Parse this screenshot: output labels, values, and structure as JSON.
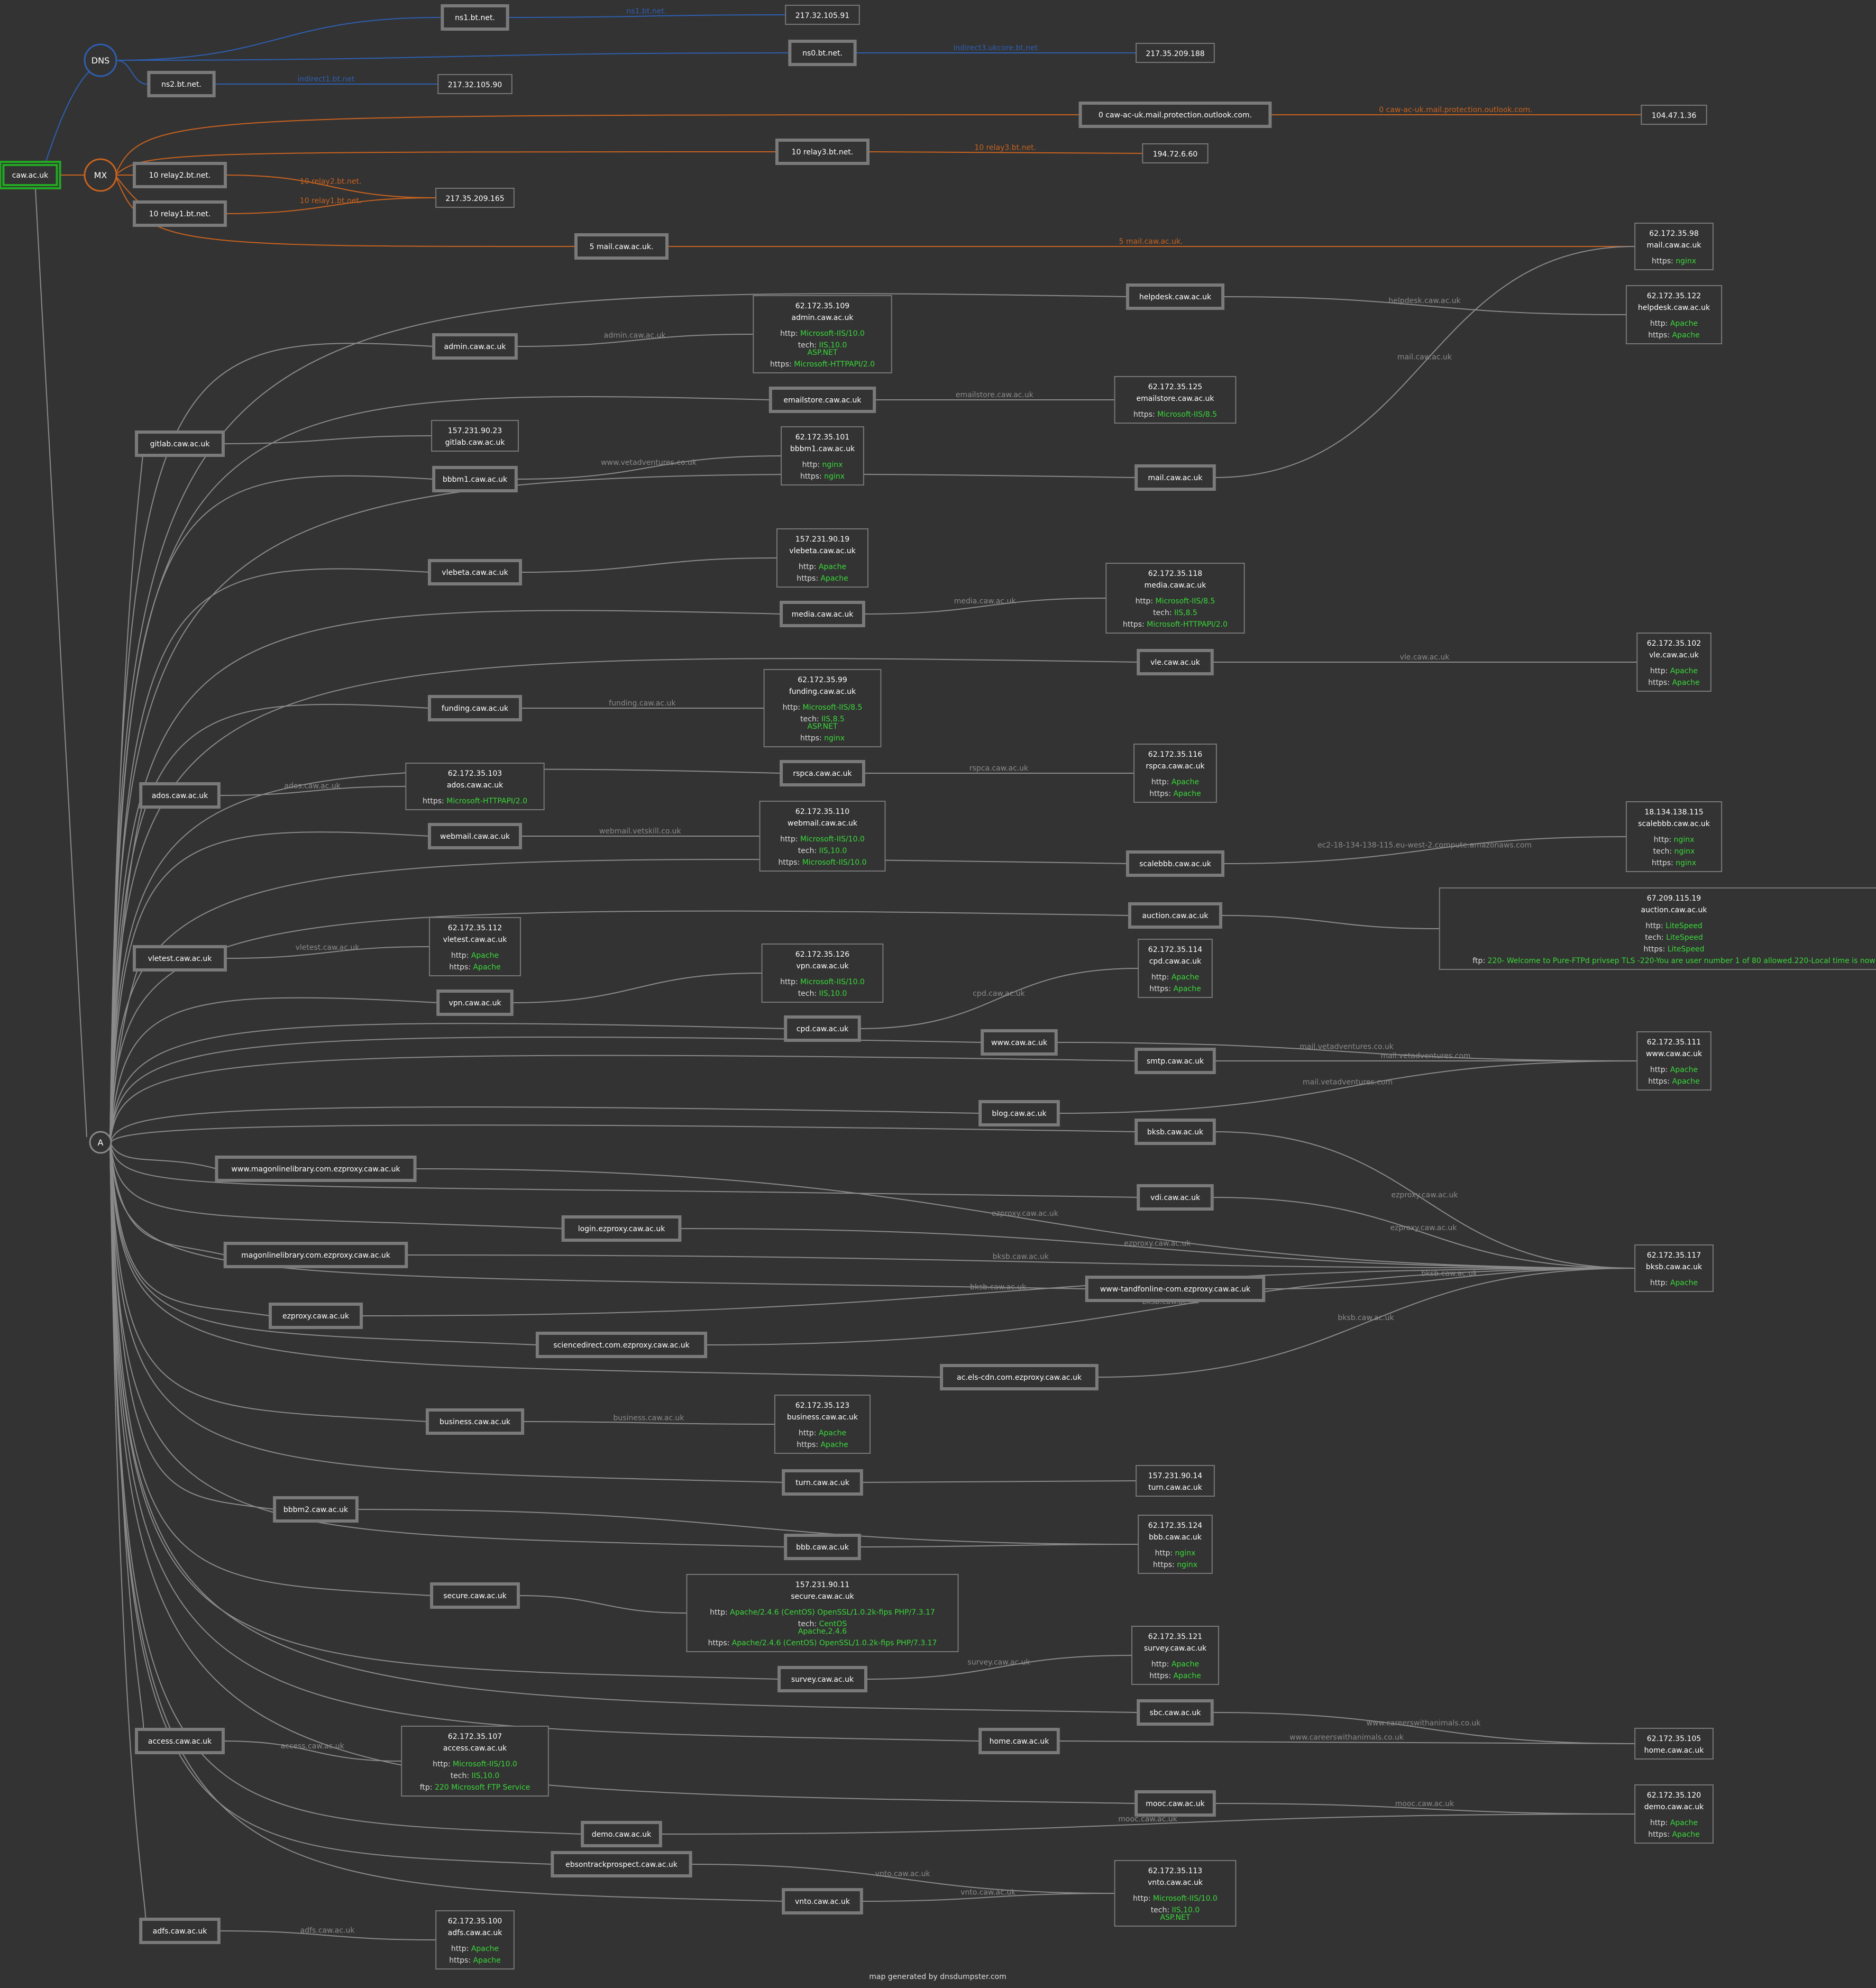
{
  "footer": "map generated by dnsdumpster.com",
  "colors": {
    "background": "#333333",
    "dns": "#2e5fb0",
    "mx": "#c8621f",
    "a": "#8a8a8a",
    "value": "#39d839",
    "root": "#22aa22"
  },
  "root": "caw.ac.uk",
  "hubs": [
    {
      "id": "DNS",
      "label": "DNS"
    },
    {
      "id": "MX",
      "label": "MX"
    },
    {
      "id": "A",
      "label": "A"
    }
  ],
  "dns_records": [
    {
      "host": "ns1.bt.net.",
      "ip": "217.32.105.91",
      "edge_label": "ns1.bt.net."
    },
    {
      "host": "ns0.bt.net.",
      "ip": "217.35.209.188",
      "edge_label": "indirect3.ukcore.bt.net"
    },
    {
      "host": "ns2.bt.net.",
      "ip": "217.32.105.90",
      "edge_label": "indirect1.bt.net"
    }
  ],
  "mx_records": [
    {
      "host": "0 caw-ac-uk.mail.protection.outlook.com.",
      "ip": "104.47.1.36",
      "edge_label": "0 caw-ac-uk.mail.protection.outlook.com."
    },
    {
      "host": "10 relay3.bt.net.",
      "ip": "194.72.6.60",
      "edge_label": "10 relay3.bt.net."
    },
    {
      "host": "10 relay2.bt.net.",
      "ip": "217.35.209.165",
      "edge_label": "10 relay2.bt.net."
    },
    {
      "host": "10 relay1.bt.net.",
      "ip": "217.35.209.165",
      "edge_label": "10 relay1.bt.net."
    },
    {
      "host": "5 mail.caw.ac.uk.",
      "ip": "62.172.35.98",
      "edge_label": "5 mail.caw.ac.uk."
    }
  ],
  "ip_info": [
    {
      "ip": "217.32.105.91",
      "lines": []
    },
    {
      "ip": "217.35.209.188",
      "lines": []
    },
    {
      "ip": "217.32.105.90",
      "lines": []
    },
    {
      "ip": "104.47.1.36",
      "lines": []
    },
    {
      "ip": "194.72.6.60",
      "lines": []
    },
    {
      "ip": "217.35.209.165",
      "lines": []
    },
    {
      "ip": "62.172.35.98",
      "host": "mail.caw.ac.uk",
      "lines": [
        {
          "k": "https:",
          "v": "nginx"
        }
      ]
    },
    {
      "ip": "62.172.35.122",
      "host": "helpdesk.caw.ac.uk",
      "lines": [
        {
          "k": "http:",
          "v": "Apache"
        },
        {
          "k": "https:",
          "v": "Apache"
        }
      ]
    },
    {
      "ip": "62.172.35.109",
      "host": "admin.caw.ac.uk",
      "lines": [
        {
          "k": "http:",
          "v": "Microsoft-IIS/10.0"
        },
        {
          "k": "tech:",
          "v": "IIS,10.0"
        },
        {
          "k": "",
          "v": "ASP.NET"
        },
        {
          "k": "https:",
          "v": "Microsoft-HTTPAPI/2.0"
        }
      ]
    },
    {
      "ip": "62.172.35.125",
      "host": "emailstore.caw.ac.uk",
      "lines": [
        {
          "k": "https:",
          "v": "Microsoft-IIS/8.5"
        }
      ]
    },
    {
      "ip": "157.231.90.23",
      "host": "gitlab.caw.ac.uk",
      "lines": []
    },
    {
      "ip": "62.172.35.101",
      "host": "bbbm1.caw.ac.uk",
      "lines": [
        {
          "k": "http:",
          "v": "nginx"
        },
        {
          "k": "https:",
          "v": "nginx"
        }
      ]
    },
    {
      "ip": "157.231.90.19",
      "host": "vlebeta.caw.ac.uk",
      "lines": [
        {
          "k": "http:",
          "v": "Apache"
        },
        {
          "k": "https:",
          "v": "Apache"
        }
      ]
    },
    {
      "ip": "62.172.35.118",
      "host": "media.caw.ac.uk",
      "lines": [
        {
          "k": "http:",
          "v": "Microsoft-IIS/8.5"
        },
        {
          "k": "tech:",
          "v": "IIS,8.5"
        },
        {
          "k": "https:",
          "v": "Microsoft-HTTPAPI/2.0"
        }
      ]
    },
    {
      "ip": "62.172.35.102",
      "host": "vle.caw.ac.uk",
      "lines": [
        {
          "k": "http:",
          "v": "Apache"
        },
        {
          "k": "https:",
          "v": "Apache"
        }
      ]
    },
    {
      "ip": "62.172.35.99",
      "host": "funding.caw.ac.uk",
      "lines": [
        {
          "k": "http:",
          "v": "Microsoft-IIS/8.5"
        },
        {
          "k": "tech:",
          "v": "IIS,8.5"
        },
        {
          "k": "",
          "v": "ASP.NET"
        },
        {
          "k": "https:",
          "v": "nginx"
        }
      ]
    },
    {
      "ip": "62.172.35.116",
      "host": "rspca.caw.ac.uk",
      "lines": [
        {
          "k": "http:",
          "v": "Apache"
        },
        {
          "k": "https:",
          "v": "Apache"
        }
      ]
    },
    {
      "ip": "62.172.35.103",
      "host": "ados.caw.ac.uk",
      "lines": [
        {
          "k": "https:",
          "v": "Microsoft-HTTPAPI/2.0"
        }
      ]
    },
    {
      "ip": "62.172.35.110",
      "host": "webmail.caw.ac.uk",
      "lines": [
        {
          "k": "http:",
          "v": "Microsoft-IIS/10.0"
        },
        {
          "k": "tech:",
          "v": "IIS,10.0"
        },
        {
          "k": "https:",
          "v": "Microsoft-IIS/10.0"
        }
      ]
    },
    {
      "ip": "18.134.138.115",
      "host": "scalebbb.caw.ac.uk",
      "lines": [
        {
          "k": "http:",
          "v": "nginx"
        },
        {
          "k": "tech:",
          "v": "nginx"
        },
        {
          "k": "https:",
          "v": "nginx"
        }
      ]
    },
    {
      "ip": "67.209.115.19",
      "host": "auction.caw.ac.uk",
      "lines": [
        {
          "k": "http:",
          "v": "LiteSpeed"
        },
        {
          "k": "tech:",
          "v": "LiteSpeed"
        },
        {
          "k": "https:",
          "v": "LiteSpeed"
        },
        {
          "k": "ftp:",
          "v": "220- Welcome to Pure-FTPd privsep TLS -220-You are user number 1 of 80 allowed.220-Local time is now"
        }
      ]
    },
    {
      "ip": "62.172.35.112",
      "host": "vletest.caw.ac.uk",
      "lines": [
        {
          "k": "http:",
          "v": "Apache"
        },
        {
          "k": "https:",
          "v": "Apache"
        }
      ]
    },
    {
      "ip": "62.172.35.126",
      "host": "vpn.caw.ac.uk",
      "lines": [
        {
          "k": "http:",
          "v": "Microsoft-IIS/10.0"
        },
        {
          "k": "tech:",
          "v": "IIS,10.0"
        }
      ]
    },
    {
      "ip": "62.172.35.114",
      "host": "cpd.caw.ac.uk",
      "lines": [
        {
          "k": "http:",
          "v": "Apache"
        },
        {
          "k": "https:",
          "v": "Apache"
        }
      ]
    },
    {
      "ip": "62.172.35.111",
      "host": "www.caw.ac.uk",
      "lines": [
        {
          "k": "http:",
          "v": "Apache"
        },
        {
          "k": "https:",
          "v": "Apache"
        }
      ]
    },
    {
      "ip": "62.172.35.117",
      "host": "bksb.caw.ac.uk",
      "lines": [
        {
          "k": "http:",
          "v": "Apache"
        }
      ]
    },
    {
      "ip": "62.172.35.123",
      "host": "business.caw.ac.uk",
      "lines": [
        {
          "k": "http:",
          "v": "Apache"
        },
        {
          "k": "https:",
          "v": "Apache"
        }
      ]
    },
    {
      "ip": "157.231.90.14",
      "host": "turn.caw.ac.uk",
      "lines": []
    },
    {
      "ip": "62.172.35.124",
      "host": "bbb.caw.ac.uk",
      "lines": [
        {
          "k": "http:",
          "v": "nginx"
        },
        {
          "k": "https:",
          "v": "nginx"
        }
      ]
    },
    {
      "ip": "157.231.90.11",
      "host": "secure.caw.ac.uk",
      "lines": [
        {
          "k": "http:",
          "v": "Apache/2.4.6 (CentOS) OpenSSL/1.0.2k-fips PHP/7.3.17"
        },
        {
          "k": "tech:",
          "v": "CentOS"
        },
        {
          "k": "",
          "v": "Apache,2.4.6"
        },
        {
          "k": "https:",
          "v": "Apache/2.4.6 (CentOS) OpenSSL/1.0.2k-fips PHP/7.3.17"
        }
      ]
    },
    {
      "ip": "62.172.35.121",
      "host": "survey.caw.ac.uk",
      "lines": [
        {
          "k": "http:",
          "v": "Apache"
        },
        {
          "k": "https:",
          "v": "Apache"
        }
      ]
    },
    {
      "ip": "62.172.35.105",
      "host": "home.caw.ac.uk",
      "lines": []
    },
    {
      "ip": "62.172.35.107",
      "host": "access.caw.ac.uk",
      "lines": [
        {
          "k": "http:",
          "v": "Microsoft-IIS/10.0"
        },
        {
          "k": "tech:",
          "v": "IIS,10.0"
        },
        {
          "k": "ftp:",
          "v": "220 Microsoft FTP Service"
        }
      ]
    },
    {
      "ip": "62.172.35.120",
      "host": "demo.caw.ac.uk",
      "lines": [
        {
          "k": "http:",
          "v": "Apache"
        },
        {
          "k": "https:",
          "v": "Apache"
        }
      ]
    },
    {
      "ip": "62.172.35.113",
      "host": "vnto.caw.ac.uk",
      "lines": [
        {
          "k": "http:",
          "v": "Microsoft-IIS/10.0"
        },
        {
          "k": "tech:",
          "v": "IIS,10.0"
        },
        {
          "k": "",
          "v": "ASP.NET"
        }
      ]
    },
    {
      "ip": "62.172.35.100",
      "host": "adfs.caw.ac.uk",
      "lines": [
        {
          "k": "http:",
          "v": "Apache"
        },
        {
          "k": "https:",
          "v": "Apache"
        }
      ]
    }
  ],
  "a_records": [
    {
      "host": "helpdesk.caw.ac.uk",
      "ip": "62.172.35.122",
      "edge_label": "helpdesk.caw.ac.uk"
    },
    {
      "host": "admin.caw.ac.uk",
      "ip": "62.172.35.109",
      "edge_label": "admin.caw.ac.uk"
    },
    {
      "host": "emailstore.caw.ac.uk",
      "ip": "62.172.35.125",
      "edge_label": "emailstore.caw.ac.uk"
    },
    {
      "host": "gitlab.caw.ac.uk",
      "ip": "157.231.90.23",
      "edge_label": ""
    },
    {
      "host": "bbbm1.caw.ac.uk",
      "ip": "62.172.35.101",
      "edge_label": "www.vetadventures.co.uk"
    },
    {
      "host": "mail.caw.ac.uk",
      "ip": "62.172.35.98",
      "edge_label": "mail.caw.ac.uk"
    },
    {
      "host": "vlebeta.caw.ac.uk",
      "ip": "157.231.90.19",
      "edge_label": ""
    },
    {
      "host": "media.caw.ac.uk",
      "ip": "62.172.35.118",
      "edge_label": "media.caw.ac.uk"
    },
    {
      "host": "vle.caw.ac.uk",
      "ip": "62.172.35.102",
      "edge_label": "vle.caw.ac.uk"
    },
    {
      "host": "funding.caw.ac.uk",
      "ip": "62.172.35.99",
      "edge_label": "funding.caw.ac.uk"
    },
    {
      "host": "rspca.caw.ac.uk",
      "ip": "62.172.35.116",
      "edge_label": "rspca.caw.ac.uk"
    },
    {
      "host": "ados.caw.ac.uk",
      "ip": "62.172.35.103",
      "edge_label": "ados.caw.ac.uk"
    },
    {
      "host": "webmail.caw.ac.uk",
      "ip": "62.172.35.110",
      "edge_label": "webmail.vetskill.co.uk"
    },
    {
      "host": "scalebbb.caw.ac.uk",
      "ip": "18.134.138.115",
      "edge_label": "ec2-18-134-138-115.eu-west-2.compute.amazonaws.com"
    },
    {
      "host": "auction.caw.ac.uk",
      "ip": "67.209.115.19",
      "edge_label": ""
    },
    {
      "host": "vletest.caw.ac.uk",
      "ip": "62.172.35.112",
      "edge_label": "vletest.caw.ac.uk"
    },
    {
      "host": "vpn.caw.ac.uk",
      "ip": "62.172.35.126",
      "edge_label": ""
    },
    {
      "host": "cpd.caw.ac.uk",
      "ip": "62.172.35.114",
      "edge_label": "cpd.caw.ac.uk"
    },
    {
      "host": "www.caw.ac.uk",
      "ip": "62.172.35.111",
      "edge_label": "mail.vetadventures.co.uk"
    },
    {
      "host": "smtp.caw.ac.uk",
      "ip": "62.172.35.111",
      "edge_label": "mail.vetadventures.com"
    },
    {
      "host": "blog.caw.ac.uk",
      "ip": "62.172.35.111",
      "edge_label": "mail.vetadventures.com"
    },
    {
      "host": "bksb.caw.ac.uk",
      "ip": "62.172.35.117",
      "edge_label": "ezproxy.caw.ac.uk"
    },
    {
      "host": "www.magonlinelibrary.com.ezproxy.caw.ac.uk",
      "ip": "62.172.35.117",
      "edge_label": "ezproxy.caw.ac.uk"
    },
    {
      "host": "vdi.caw.ac.uk",
      "ip": "62.172.35.117",
      "edge_label": "ezproxy.caw.ac.uk"
    },
    {
      "host": "login.ezproxy.caw.ac.uk",
      "ip": "62.172.35.117",
      "edge_label": "ezproxy.caw.ac.uk"
    },
    {
      "host": "magonlinelibrary.com.ezproxy.caw.ac.uk",
      "ip": "62.172.35.117",
      "edge_label": "bksb.caw.ac.uk"
    },
    {
      "host": "www-tandfonline-com.ezproxy.caw.ac.uk",
      "ip": "62.172.35.117",
      "edge_label": "bksb.caw.ac.uk"
    },
    {
      "host": "ezproxy.caw.ac.uk",
      "ip": "62.172.35.117",
      "edge_label": "bksb.caw.ac.uk"
    },
    {
      "host": "sciencedirect.com.ezproxy.caw.ac.uk",
      "ip": "62.172.35.117",
      "edge_label": "bksb.caw.ac.uk"
    },
    {
      "host": "ac.els-cdn.com.ezproxy.caw.ac.uk",
      "ip": "62.172.35.117",
      "edge_label": "bksb.caw.ac.uk"
    },
    {
      "host": "business.caw.ac.uk",
      "ip": "62.172.35.123",
      "edge_label": "business.caw.ac.uk"
    },
    {
      "host": "turn.caw.ac.uk",
      "ip": "157.231.90.14",
      "edge_label": ""
    },
    {
      "host": "bbbm2.caw.ac.uk",
      "ip": "62.172.35.124",
      "edge_label": ""
    },
    {
      "host": "bbb.caw.ac.uk",
      "ip": "62.172.35.124",
      "edge_label": ""
    },
    {
      "host": "secure.caw.ac.uk",
      "ip": "157.231.90.11",
      "edge_label": ""
    },
    {
      "host": "survey.caw.ac.uk",
      "ip": "62.172.35.121",
      "edge_label": "survey.caw.ac.uk"
    },
    {
      "host": "sbc.caw.ac.uk",
      "ip": "62.172.35.105",
      "edge_label": "www.careerswithanimals.co.uk"
    },
    {
      "host": "home.caw.ac.uk",
      "ip": "62.172.35.105",
      "edge_label": "www.careerswithanimals.co.uk"
    },
    {
      "host": "access.caw.ac.uk",
      "ip": "62.172.35.107",
      "edge_label": "access.caw.ac.uk"
    },
    {
      "host": "mooc.caw.ac.uk",
      "ip": "62.172.35.120",
      "edge_label": "mooc.caw.ac.uk"
    },
    {
      "host": "demo.caw.ac.uk",
      "ip": "62.172.35.120",
      "edge_label": "mooc.caw.ac.uk"
    },
    {
      "host": "ebsontrackprospect.caw.ac.uk",
      "ip": "62.172.35.113",
      "edge_label": "vnto.caw.ac.uk"
    },
    {
      "host": "vnto.caw.ac.uk",
      "ip": "62.172.35.113",
      "edge_label": "vnto.caw.ac.uk"
    },
    {
      "host": "adfs.caw.ac.uk",
      "ip": "62.172.35.100",
      "edge_label": "adfs.caw.ac.uk"
    }
  ]
}
